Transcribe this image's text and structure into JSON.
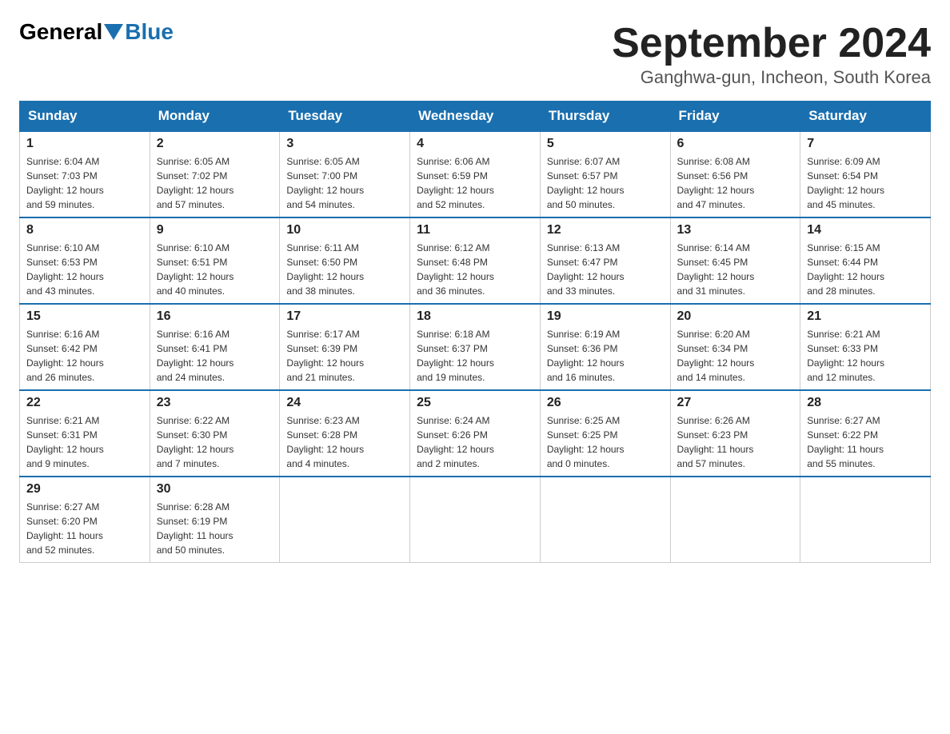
{
  "header": {
    "logo_general": "General",
    "logo_blue": "Blue",
    "month_title": "September 2024",
    "location": "Ganghwa-gun, Incheon, South Korea"
  },
  "days_of_week": [
    "Sunday",
    "Monday",
    "Tuesday",
    "Wednesday",
    "Thursday",
    "Friday",
    "Saturday"
  ],
  "weeks": [
    [
      {
        "day": "1",
        "sunrise": "6:04 AM",
        "sunset": "7:03 PM",
        "daylight": "12 hours and 59 minutes."
      },
      {
        "day": "2",
        "sunrise": "6:05 AM",
        "sunset": "7:02 PM",
        "daylight": "12 hours and 57 minutes."
      },
      {
        "day": "3",
        "sunrise": "6:05 AM",
        "sunset": "7:00 PM",
        "daylight": "12 hours and 54 minutes."
      },
      {
        "day": "4",
        "sunrise": "6:06 AM",
        "sunset": "6:59 PM",
        "daylight": "12 hours and 52 minutes."
      },
      {
        "day": "5",
        "sunrise": "6:07 AM",
        "sunset": "6:57 PM",
        "daylight": "12 hours and 50 minutes."
      },
      {
        "day": "6",
        "sunrise": "6:08 AM",
        "sunset": "6:56 PM",
        "daylight": "12 hours and 47 minutes."
      },
      {
        "day": "7",
        "sunrise": "6:09 AM",
        "sunset": "6:54 PM",
        "daylight": "12 hours and 45 minutes."
      }
    ],
    [
      {
        "day": "8",
        "sunrise": "6:10 AM",
        "sunset": "6:53 PM",
        "daylight": "12 hours and 43 minutes."
      },
      {
        "day": "9",
        "sunrise": "6:10 AM",
        "sunset": "6:51 PM",
        "daylight": "12 hours and 40 minutes."
      },
      {
        "day": "10",
        "sunrise": "6:11 AM",
        "sunset": "6:50 PM",
        "daylight": "12 hours and 38 minutes."
      },
      {
        "day": "11",
        "sunrise": "6:12 AM",
        "sunset": "6:48 PM",
        "daylight": "12 hours and 36 minutes."
      },
      {
        "day": "12",
        "sunrise": "6:13 AM",
        "sunset": "6:47 PM",
        "daylight": "12 hours and 33 minutes."
      },
      {
        "day": "13",
        "sunrise": "6:14 AM",
        "sunset": "6:45 PM",
        "daylight": "12 hours and 31 minutes."
      },
      {
        "day": "14",
        "sunrise": "6:15 AM",
        "sunset": "6:44 PM",
        "daylight": "12 hours and 28 minutes."
      }
    ],
    [
      {
        "day": "15",
        "sunrise": "6:16 AM",
        "sunset": "6:42 PM",
        "daylight": "12 hours and 26 minutes."
      },
      {
        "day": "16",
        "sunrise": "6:16 AM",
        "sunset": "6:41 PM",
        "daylight": "12 hours and 24 minutes."
      },
      {
        "day": "17",
        "sunrise": "6:17 AM",
        "sunset": "6:39 PM",
        "daylight": "12 hours and 21 minutes."
      },
      {
        "day": "18",
        "sunrise": "6:18 AM",
        "sunset": "6:37 PM",
        "daylight": "12 hours and 19 minutes."
      },
      {
        "day": "19",
        "sunrise": "6:19 AM",
        "sunset": "6:36 PM",
        "daylight": "12 hours and 16 minutes."
      },
      {
        "day": "20",
        "sunrise": "6:20 AM",
        "sunset": "6:34 PM",
        "daylight": "12 hours and 14 minutes."
      },
      {
        "day": "21",
        "sunrise": "6:21 AM",
        "sunset": "6:33 PM",
        "daylight": "12 hours and 12 minutes."
      }
    ],
    [
      {
        "day": "22",
        "sunrise": "6:21 AM",
        "sunset": "6:31 PM",
        "daylight": "12 hours and 9 minutes."
      },
      {
        "day": "23",
        "sunrise": "6:22 AM",
        "sunset": "6:30 PM",
        "daylight": "12 hours and 7 minutes."
      },
      {
        "day": "24",
        "sunrise": "6:23 AM",
        "sunset": "6:28 PM",
        "daylight": "12 hours and 4 minutes."
      },
      {
        "day": "25",
        "sunrise": "6:24 AM",
        "sunset": "6:26 PM",
        "daylight": "12 hours and 2 minutes."
      },
      {
        "day": "26",
        "sunrise": "6:25 AM",
        "sunset": "6:25 PM",
        "daylight": "12 hours and 0 minutes."
      },
      {
        "day": "27",
        "sunrise": "6:26 AM",
        "sunset": "6:23 PM",
        "daylight": "11 hours and 57 minutes."
      },
      {
        "day": "28",
        "sunrise": "6:27 AM",
        "sunset": "6:22 PM",
        "daylight": "11 hours and 55 minutes."
      }
    ],
    [
      {
        "day": "29",
        "sunrise": "6:27 AM",
        "sunset": "6:20 PM",
        "daylight": "11 hours and 52 minutes."
      },
      {
        "day": "30",
        "sunrise": "6:28 AM",
        "sunset": "6:19 PM",
        "daylight": "11 hours and 50 minutes."
      },
      null,
      null,
      null,
      null,
      null
    ]
  ],
  "labels": {
    "sunrise": "Sunrise:",
    "sunset": "Sunset:",
    "daylight": "Daylight:"
  }
}
